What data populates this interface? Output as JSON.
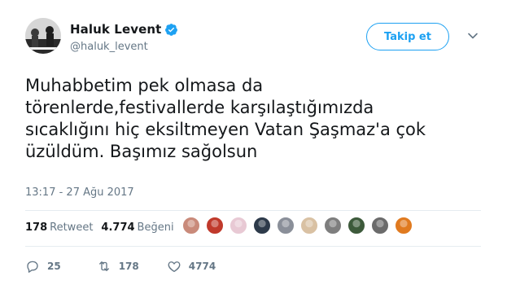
{
  "user": {
    "name": "Haluk Levent",
    "handle": "@haluk_levent",
    "verified_icon": "verified-badge-icon",
    "follow_label": "Takip et"
  },
  "tweet": {
    "text_lines": [
      "Muhabbetim pek olmasa da",
      "törenlerde,festivallerde karşılaştığımızda",
      "sıcaklığını hiç eksiltmeyen Vatan Şaşmaz'a çok",
      "üzüldüm. Başımız sağolsun"
    ],
    "timestamp": "13:17 - 27 Ağu 2017"
  },
  "stats": {
    "retweet_count": "178",
    "retweet_label": "Retweet",
    "like_count": "4.774",
    "like_label": "Beğeni"
  },
  "likers_colors": [
    "#c98a7a",
    "#c0392b",
    "#e8c9d4",
    "#2d3a4a",
    "#8a8f99",
    "#d9c1a3",
    "#7e7e7e",
    "#3d5a3b",
    "#6b6b6b",
    "#e07a1f"
  ],
  "actions": {
    "reply_count": "25",
    "retweet_count": "178",
    "like_count": "4774"
  },
  "colors": {
    "accent": "#1da1f2",
    "text": "#14171a",
    "muted": "#657786",
    "border": "#e6ecf0"
  }
}
